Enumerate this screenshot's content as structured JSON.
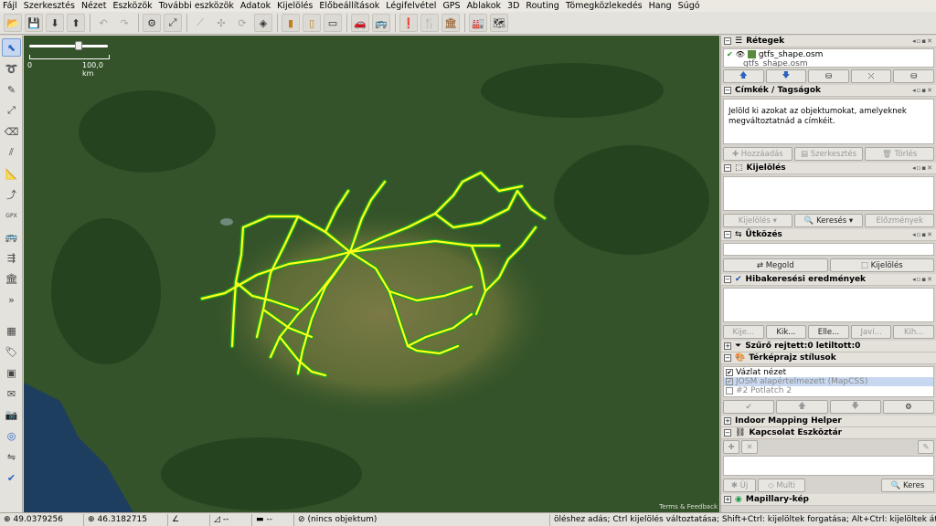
{
  "menu": [
    "Fájl",
    "Szerkesztés",
    "Nézet",
    "Eszközök",
    "További eszközök",
    "Adatok",
    "Kijelölés",
    "Előbeállítások",
    "Légifelvétel",
    "GPS",
    "Ablakok",
    "3D",
    "Routing",
    "Tömegközlekedés",
    "Hang",
    "Súgó"
  ],
  "toolbar": {
    "icons": [
      "open-icon",
      "save-icon",
      "download-icon",
      "upload-icon",
      "undo-icon",
      "redo-icon",
      "preferences-icon",
      "zoom-icon",
      "simplify-icon",
      "align-icon",
      "rotate-icon",
      "multipolygon-icon",
      "pt-stop-icon",
      "pt-station-icon",
      "pt-platform-icon",
      "car-icon",
      "bus-icon",
      "warning-icon",
      "restaurant-icon",
      "building-icon",
      "industrial-icon",
      "map-icon"
    ]
  },
  "lefttools": [
    "select-icon",
    "lasso-icon",
    "draw-icon",
    "zoom-icon",
    "delete-icon",
    "parallel-icon",
    "measure-icon",
    "improve-way-icon",
    "gpx-icon",
    "bus-icon",
    "route-icon",
    "building-icon",
    "more-icon",
    "slippy-icon",
    "tag-icon",
    "imagery-icon",
    "notes-icon",
    "photo-icon",
    "mapillary-icon",
    "status-icon",
    "validate-icon"
  ],
  "map": {
    "scale_zero": "0",
    "scale_label": "100,0 km",
    "attribution": "Terms & Feedback"
  },
  "layers": {
    "title": "Rétegek",
    "items": [
      {
        "name": "gtfs_shape.osm",
        "active": true
      },
      {
        "name": "gtfs_shape.osm",
        "active": false
      }
    ]
  },
  "tags": {
    "title": "Címkék / Tagságok",
    "message": "Jelöld ki azokat az objektumokat, amelyeknek megváltoztatnád a címkéit.",
    "buttons": [
      "Hozzáadás",
      "Szerkesztés",
      "Törlés"
    ]
  },
  "selection": {
    "title": "Kijelölés",
    "buttons": [
      "Kijelölés",
      "Keresés",
      "Előzmények"
    ]
  },
  "conflict": {
    "title": "Ütközés",
    "buttons": [
      "Megold",
      "Kijelölés"
    ]
  },
  "validator": {
    "title": "Hibakeresési eredmények",
    "buttons": [
      "Kije...",
      "Kik...",
      "Elle...",
      "Javí...",
      "Kih..."
    ]
  },
  "filter": {
    "title": "Szűrő rejtett:0 letiltott:0"
  },
  "styles": {
    "title": "Térképrajz stílusok",
    "items": [
      {
        "name": "Vázlat nézet",
        "checked": true,
        "state": "normal"
      },
      {
        "name": "JOSM alapértelmezett (MapCSS)",
        "checked": true,
        "state": "disabled"
      },
      {
        "name": "#2 Potlatch 2",
        "checked": false,
        "state": "disabled"
      }
    ]
  },
  "indoor": {
    "title": "Indoor Mapping Helper"
  },
  "relation": {
    "title": "Kapcsolat Eszköztár",
    "buttons": [
      "Új",
      "Multi",
      "Keres"
    ]
  },
  "mapillary": {
    "title": "Mapillary-kép"
  },
  "status": {
    "lat": "49.0379256",
    "lon": "46.3182715",
    "angle": "",
    "heading": "--",
    "selection": "(nincs objektum)",
    "hint": "öléshez adás; Ctrl kijelölés változtatása; Shift+Ctrl: kijelöltek forgatása; Alt+Ctrl: kijelöltek átméretezése"
  },
  "colors": {
    "accent": "#3a6fc2",
    "route": "#ffff1a",
    "route_glow": "#1f9e1f"
  }
}
